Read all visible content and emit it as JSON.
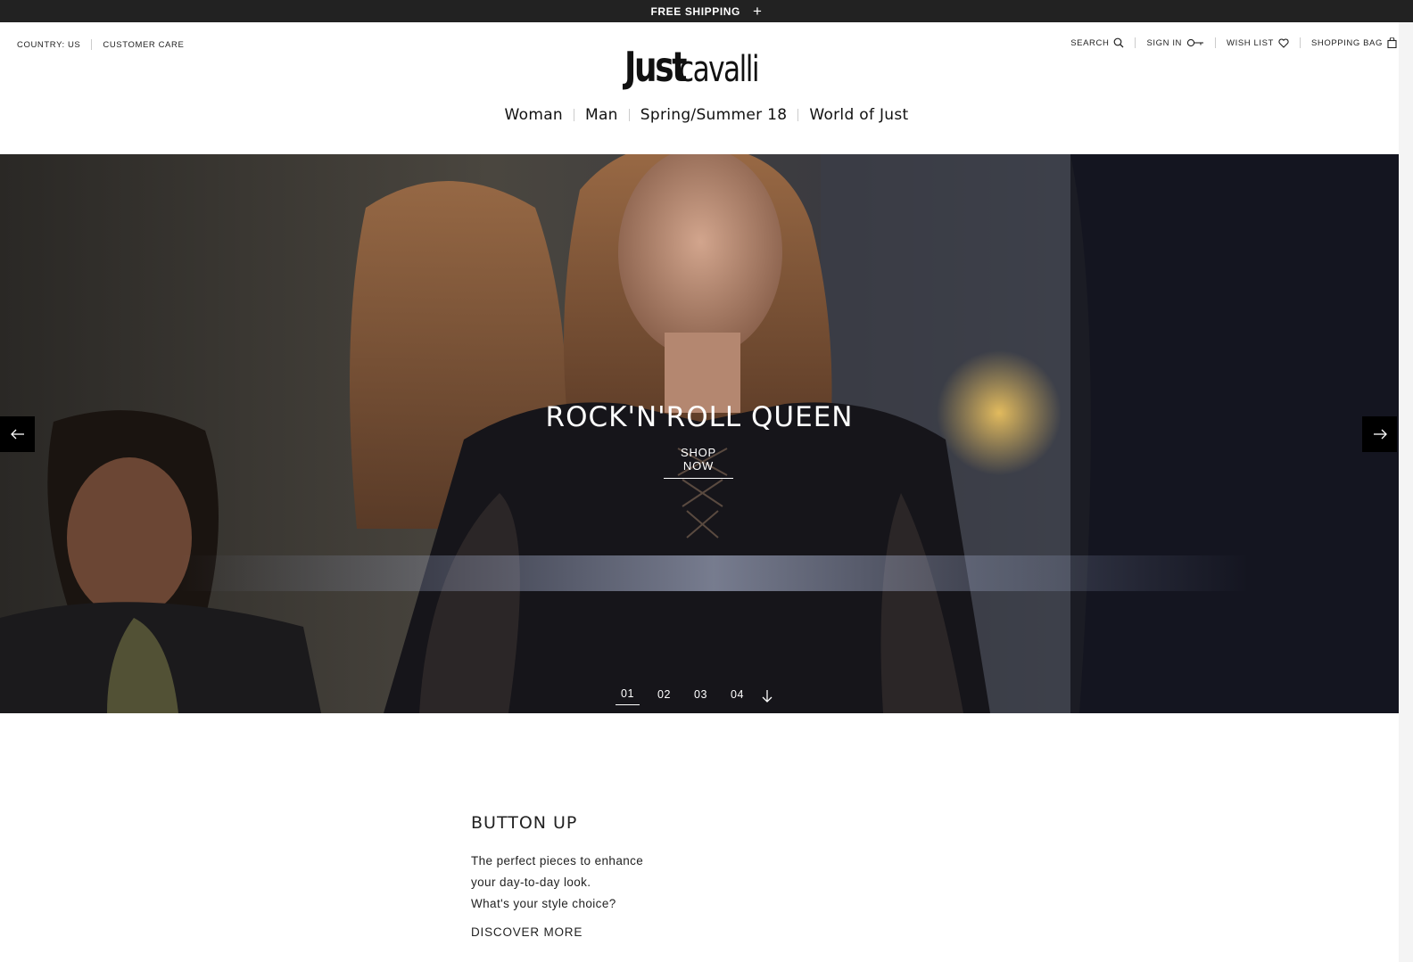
{
  "promo": {
    "text": "FREE SHIPPING",
    "toggle": "+"
  },
  "utility_left": {
    "country": "COUNTRY: US",
    "customer_care": "CUSTOMER CARE"
  },
  "utility_right": {
    "search": "SEARCH",
    "sign_in": "SIGN IN",
    "wish_list": "WISH LIST",
    "shopping_bag": "SHOPPING BAG"
  },
  "logo": {
    "just": "Just",
    "cavalli": "cavalli"
  },
  "main_nav": [
    {
      "label": "Woman"
    },
    {
      "label": "Man"
    },
    {
      "label": "Spring/Summer 18"
    },
    {
      "label": "World of Just"
    }
  ],
  "hero": {
    "title": "ROCK'N'ROLL QUEEN",
    "cta": "SHOP NOW",
    "slides": [
      "01",
      "02",
      "03",
      "04"
    ],
    "active_slide": "01"
  },
  "feature": {
    "title": "BUTTON UP",
    "description_lines": [
      "The perfect pieces to enhance",
      "your day-to-day look.",
      "What's your style choice?"
    ],
    "cta": "DISCOVER MORE"
  },
  "colors": {
    "promo_bg": "#222222",
    "text": "#111111",
    "arrow_bg": "#000000"
  }
}
